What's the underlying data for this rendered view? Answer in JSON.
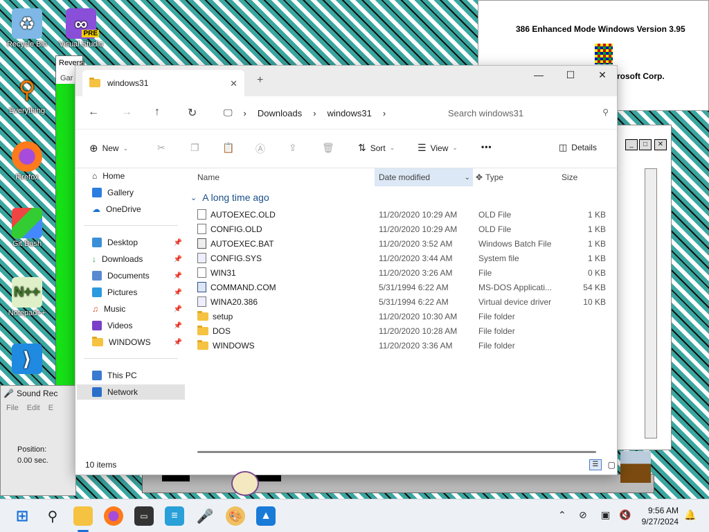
{
  "desktop": {
    "icons": [
      {
        "label": "Recycle Bin"
      },
      {
        "label": "Visual Studio",
        "badge": "PRE"
      },
      {
        "label": "Everything"
      },
      {
        "label": "Firefox"
      },
      {
        "label": "Git Bash"
      },
      {
        "label": "Notepad++"
      },
      {
        "label": ""
      }
    ]
  },
  "win31_about": {
    "line1": "386 Enhanced Mode Windows Version 3.95",
    "line2": "rosoft Corp."
  },
  "reversi": {
    "title": "Reversi",
    "menu": "Gar"
  },
  "sound_recorder": {
    "title": "Sound Rec",
    "menu": [
      "File",
      "Edit",
      "E"
    ],
    "position_label": "Position:",
    "position_value": "0.00 sec."
  },
  "explorer": {
    "tab_title": "windows31",
    "breadcrumb": [
      "Downloads",
      "windows31"
    ],
    "search_placeholder": "Search windows31",
    "toolbar": {
      "new_label": "New",
      "sort_label": "Sort",
      "view_label": "View",
      "more_label": "•••",
      "details_label": "Details"
    },
    "sidebar": {
      "top": [
        "Home",
        "Gallery",
        "OneDrive"
      ],
      "pinned": [
        "Desktop",
        "Downloads",
        "Documents",
        "Pictures",
        "Music",
        "Videos",
        "WINDOWS"
      ],
      "bottom": [
        "This PC",
        "Network"
      ]
    },
    "columns": {
      "name": "Name",
      "date": "Date modified",
      "type": "Type",
      "size": "Size"
    },
    "group_label": "A long time ago",
    "files": [
      {
        "name": "AUTOEXEC.OLD",
        "date": "11/20/2020 10:29 AM",
        "type": "OLD File",
        "size": "1 KB",
        "icon": "file"
      },
      {
        "name": "CONFIG.OLD",
        "date": "11/20/2020 10:29 AM",
        "type": "OLD File",
        "size": "1 KB",
        "icon": "file"
      },
      {
        "name": "AUTOEXEC.BAT",
        "date": "11/20/2020 3:52 AM",
        "type": "Windows Batch File",
        "size": "1 KB",
        "icon": "bat"
      },
      {
        "name": "CONFIG.SYS",
        "date": "11/20/2020 3:44 AM",
        "type": "System file",
        "size": "1 KB",
        "icon": "sys"
      },
      {
        "name": "WIN31",
        "date": "11/20/2020 3:26 AM",
        "type": "File",
        "size": "0 KB",
        "icon": "file"
      },
      {
        "name": "COMMAND.COM",
        "date": "5/31/1994 6:22 AM",
        "type": "MS-DOS Applicati...",
        "size": "54 KB",
        "icon": "com"
      },
      {
        "name": "WINA20.386",
        "date": "5/31/1994 6:22 AM",
        "type": "Virtual device driver",
        "size": "10 KB",
        "icon": "sys"
      },
      {
        "name": "setup",
        "date": "11/20/2020 10:30 AM",
        "type": "File folder",
        "size": "",
        "icon": "folder"
      },
      {
        "name": "DOS",
        "date": "11/20/2020 10:28 AM",
        "type": "File folder",
        "size": "",
        "icon": "folder"
      },
      {
        "name": "WINDOWS",
        "date": "11/20/2020 3:36 AM",
        "type": "File folder",
        "size": "",
        "icon": "folder"
      }
    ],
    "status_items": "10 items"
  },
  "taskbar": {
    "time": "9:56 AM",
    "date": "9/27/2024"
  }
}
